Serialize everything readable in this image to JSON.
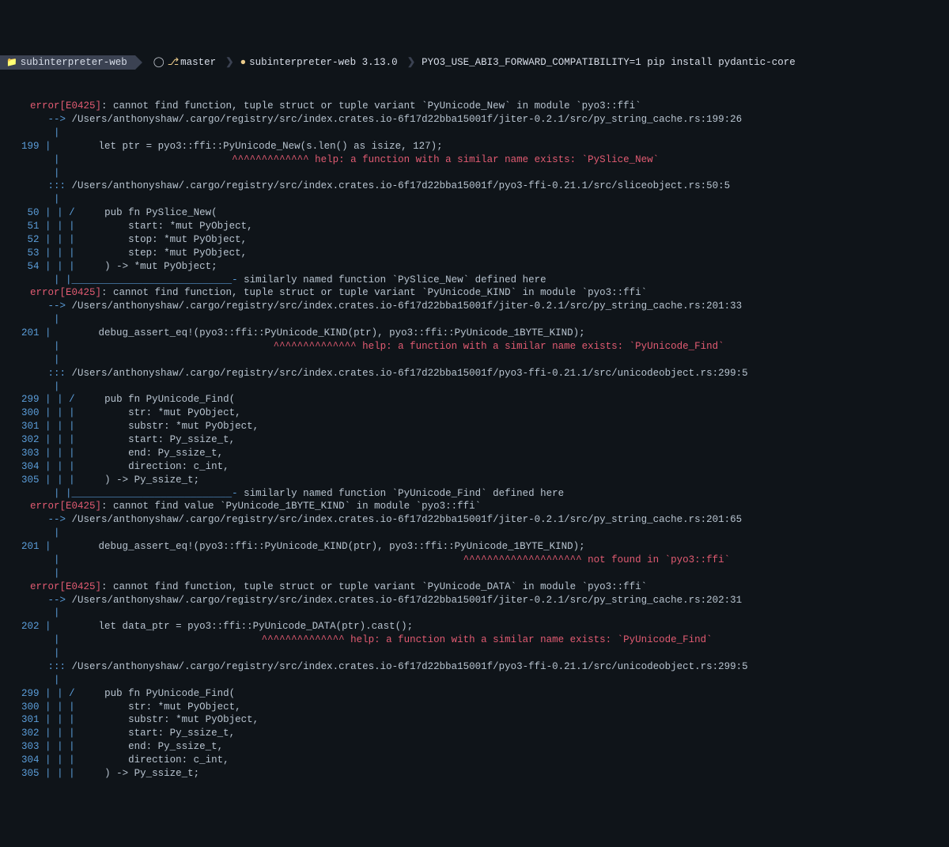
{
  "prompt": {
    "dir": "subinterpreter-web",
    "branch": "master",
    "venv": "subinterpreter-web 3.13.0",
    "command": "PYO3_USE_ABI3_FORWARD_COMPATIBILITY=1 pip install pydantic-core"
  },
  "errors": [
    {
      "code": "E0425",
      "msg": "cannot find function, tuple struct or tuple variant `PyUnicode_New` in module `pyo3::ffi`",
      "src": "/Users/anthonyshaw/.cargo/registry/src/index.crates.io-6f17d22bba15001f/jiter-0.2.1/src/py_string_cache.rs:199:26",
      "snippet": {
        "ln": "199",
        "text": "        let ptr = pyo3::ffi::PyUnicode_New(s.len() as isize, 127);",
        "caret": "                             ^^^^^^^^^^^^^ help: a function with a similar name exists: `PySlice_New`"
      },
      "note": "/Users/anthonyshaw/.cargo/registry/src/index.crates.io-6f17d22bba15001f/pyo3-ffi-0.21.1/src/sliceobject.rs:50:5",
      "def": [
        {
          "ln": "50",
          "g": "/ ",
          "text": "    pub fn PySlice_New("
        },
        {
          "ln": "51",
          "g": "| ",
          "text": "        start: *mut PyObject,"
        },
        {
          "ln": "52",
          "g": "| ",
          "text": "        stop: *mut PyObject,"
        },
        {
          "ln": "53",
          "g": "| ",
          "text": "        step: *mut PyObject,"
        },
        {
          "ln": "54",
          "g": "| ",
          "text": "    ) -> *mut PyObject;"
        }
      ],
      "defnote": "similarly named function `PySlice_New` defined here"
    },
    {
      "code": "E0425",
      "msg": "cannot find function, tuple struct or tuple variant `PyUnicode_KIND` in module `pyo3::ffi`",
      "src": "/Users/anthonyshaw/.cargo/registry/src/index.crates.io-6f17d22bba15001f/jiter-0.2.1/src/py_string_cache.rs:201:33",
      "snippet": {
        "ln": "201",
        "text": "        debug_assert_eq!(pyo3::ffi::PyUnicode_KIND(ptr), pyo3::ffi::PyUnicode_1BYTE_KIND);",
        "caret": "                                    ^^^^^^^^^^^^^^ help: a function with a similar name exists: `PyUnicode_Find`"
      },
      "note": "/Users/anthonyshaw/.cargo/registry/src/index.crates.io-6f17d22bba15001f/pyo3-ffi-0.21.1/src/unicodeobject.rs:299:5",
      "def": [
        {
          "ln": "299",
          "g": "/ ",
          "text": "    pub fn PyUnicode_Find("
        },
        {
          "ln": "300",
          "g": "| ",
          "text": "        str: *mut PyObject,"
        },
        {
          "ln": "301",
          "g": "| ",
          "text": "        substr: *mut PyObject,"
        },
        {
          "ln": "302",
          "g": "| ",
          "text": "        start: Py_ssize_t,"
        },
        {
          "ln": "303",
          "g": "| ",
          "text": "        end: Py_ssize_t,"
        },
        {
          "ln": "304",
          "g": "| ",
          "text": "        direction: c_int,"
        },
        {
          "ln": "305",
          "g": "| ",
          "text": "    ) -> Py_ssize_t;"
        }
      ],
      "defnote": "similarly named function `PyUnicode_Find` defined here"
    },
    {
      "code": "E0425",
      "msg": "cannot find value `PyUnicode_1BYTE_KIND` in module `pyo3::ffi`",
      "src": "/Users/anthonyshaw/.cargo/registry/src/index.crates.io-6f17d22bba15001f/jiter-0.2.1/src/py_string_cache.rs:201:65",
      "snippet": {
        "ln": "201",
        "text": "        debug_assert_eq!(pyo3::ffi::PyUnicode_KIND(ptr), pyo3::ffi::PyUnicode_1BYTE_KIND);",
        "caret": "                                                                    ^^^^^^^^^^^^^^^^^^^^ not found in `pyo3::ffi`"
      }
    },
    {
      "code": "E0425",
      "msg": "cannot find function, tuple struct or tuple variant `PyUnicode_DATA` in module `pyo3::ffi`",
      "src": "/Users/anthonyshaw/.cargo/registry/src/index.crates.io-6f17d22bba15001f/jiter-0.2.1/src/py_string_cache.rs:202:31",
      "snippet": {
        "ln": "202",
        "text": "        let data_ptr = pyo3::ffi::PyUnicode_DATA(ptr).cast();",
        "caret": "                                  ^^^^^^^^^^^^^^ help: a function with a similar name exists: `PyUnicode_Find`"
      },
      "note": "/Users/anthonyshaw/.cargo/registry/src/index.crates.io-6f17d22bba15001f/pyo3-ffi-0.21.1/src/unicodeobject.rs:299:5",
      "def": [
        {
          "ln": "299",
          "g": "/ ",
          "text": "    pub fn PyUnicode_Find("
        },
        {
          "ln": "300",
          "g": "| ",
          "text": "        str: *mut PyObject,"
        },
        {
          "ln": "301",
          "g": "| ",
          "text": "        substr: *mut PyObject,"
        },
        {
          "ln": "302",
          "g": "| ",
          "text": "        start: Py_ssize_t,"
        },
        {
          "ln": "303",
          "g": "| ",
          "text": "        end: Py_ssize_t,"
        },
        {
          "ln": "304",
          "g": "| ",
          "text": "        direction: c_int,"
        },
        {
          "ln": "305",
          "g": "| ",
          "text": "    ) -> Py_ssize_t;"
        }
      ]
    }
  ]
}
